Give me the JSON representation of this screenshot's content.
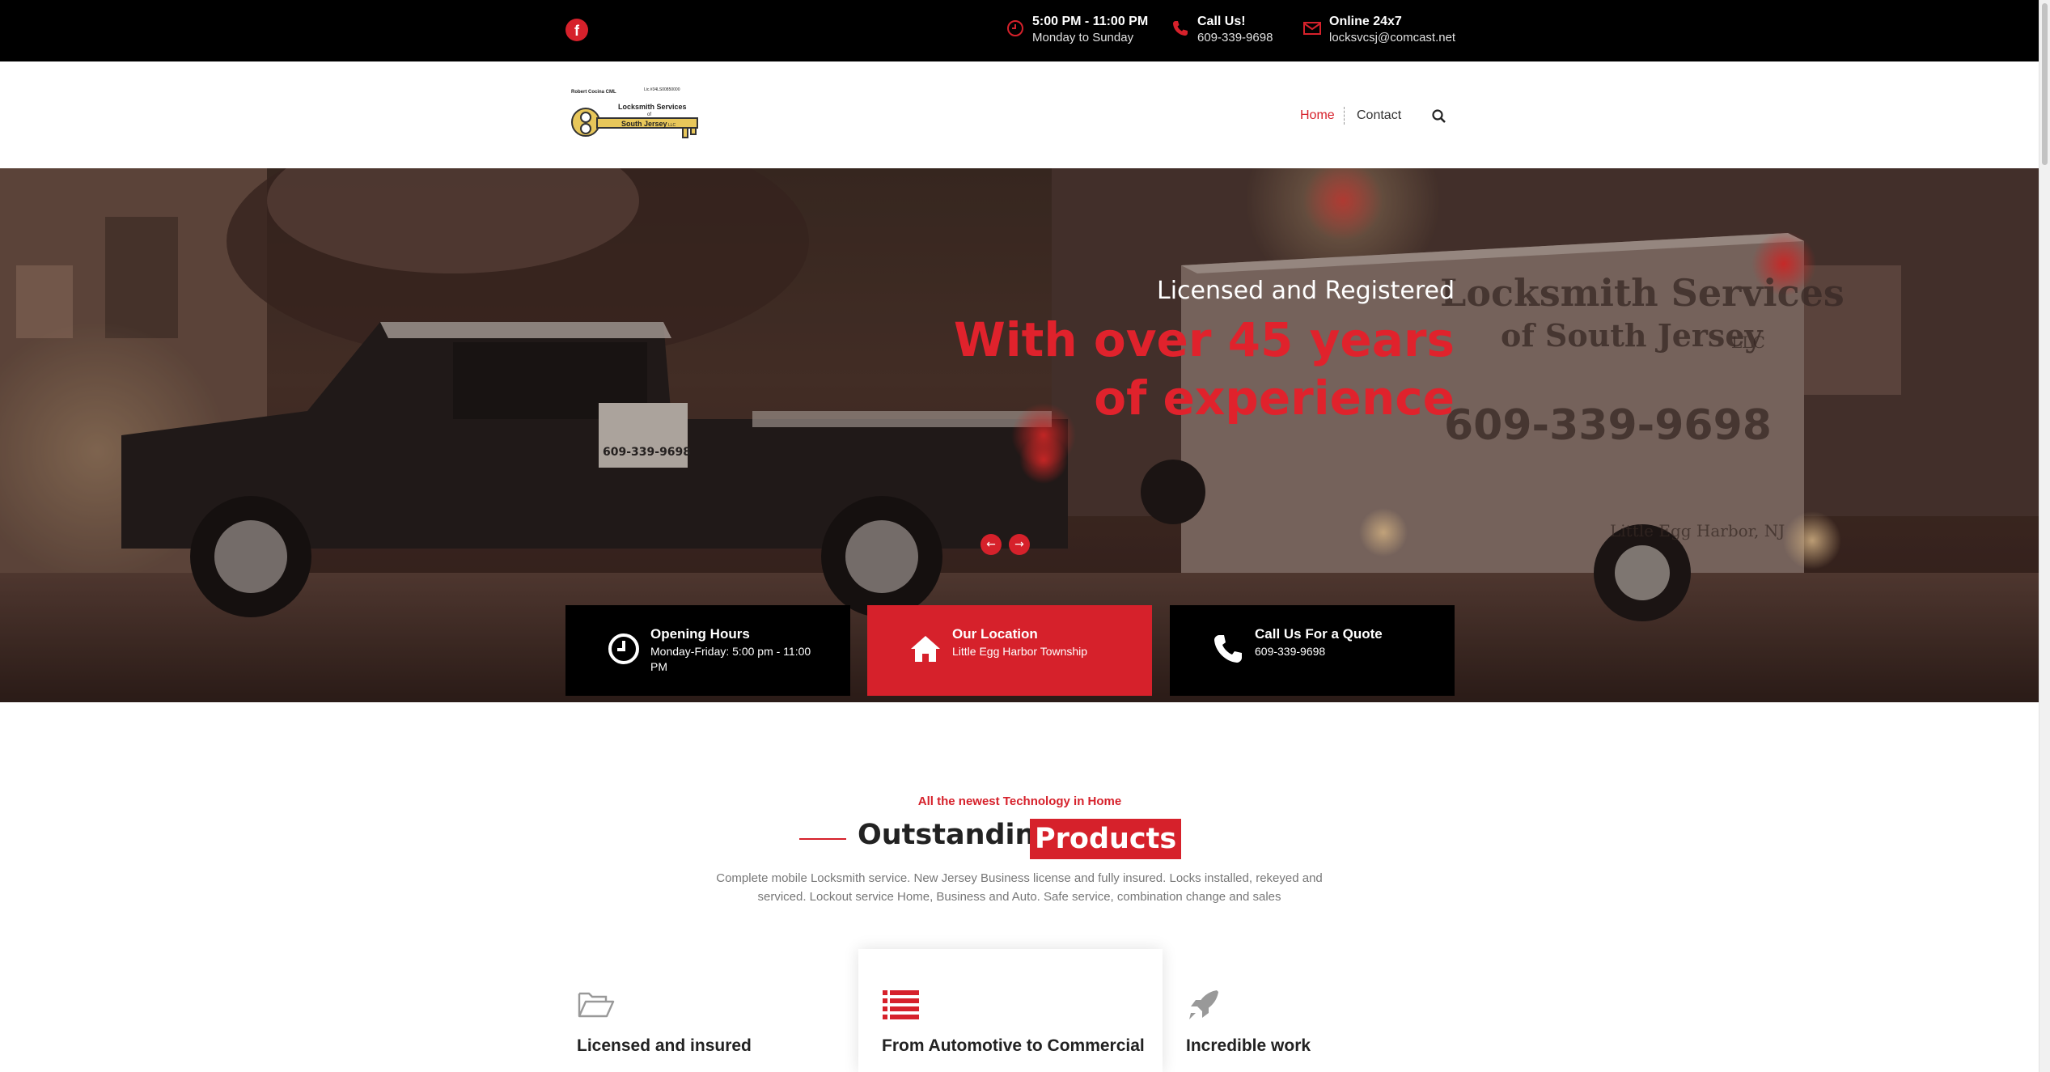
{
  "topbar": {
    "facebook_glyph": "f",
    "hours": {
      "title": "5:00 PM - 11:00 PM",
      "subtitle": "Monday to Sunday",
      "icon": "clock-icon"
    },
    "phone": {
      "title": "Call Us!",
      "subtitle": "609-339-9698",
      "icon": "phone-icon"
    },
    "email": {
      "title": "Online 24x7",
      "subtitle": "locksvcsj@comcast.net",
      "icon": "envelope-icon"
    }
  },
  "logo": {
    "line1": "Robert Cocina CML",
    "line2": "Lic.#34LS00850000",
    "line3": "Locksmith Services",
    "line4": "of",
    "line5": "South Jersey",
    "line6": "LLC"
  },
  "nav": {
    "home": "Home",
    "contact": "Contact",
    "search_icon": "search-icon"
  },
  "hero": {
    "subtitle": "Licensed and Registered",
    "title": "With over 45 years of experience",
    "prev": "←",
    "next": "→",
    "van": {
      "line1": "Locksmith Services",
      "line2": "of South Jersey",
      "line3": "LLC",
      "phone": "609-339-9698",
      "town": "Little Egg Harbor, NJ"
    },
    "truck_sign": "609-339-9698"
  },
  "info_boxes": [
    {
      "title": "Opening Hours",
      "text": "Monday-Friday: 5:00 pm - 11:00 PM",
      "icon": "clock-icon"
    },
    {
      "title": "Our Location",
      "text": "Little Egg Harbor Township",
      "icon": "home-icon"
    },
    {
      "title": "Call Us For a Quote",
      "text": "609-339-9698",
      "icon": "phone-icon"
    }
  ],
  "products": {
    "kicker": "All the newest Technology in Home",
    "heading": "Outstanding",
    "highlight": "Products",
    "description": "Complete mobile Locksmith service. New Jersey Business license and fully insured. Locks installed, rekeyed and serviced. Lockout service Home, Business and Auto. Safe service, combination change and sales",
    "features": [
      {
        "title": "Licensed and insured",
        "icon": "folder-open-icon"
      },
      {
        "title": "From Automotive to Commercial",
        "icon": "list-icon"
      },
      {
        "title": "Incredible work",
        "icon": "rocket-icon"
      }
    ]
  },
  "colors": {
    "accent": "#d6212b",
    "topbar": "#000000",
    "text": "#222222"
  }
}
